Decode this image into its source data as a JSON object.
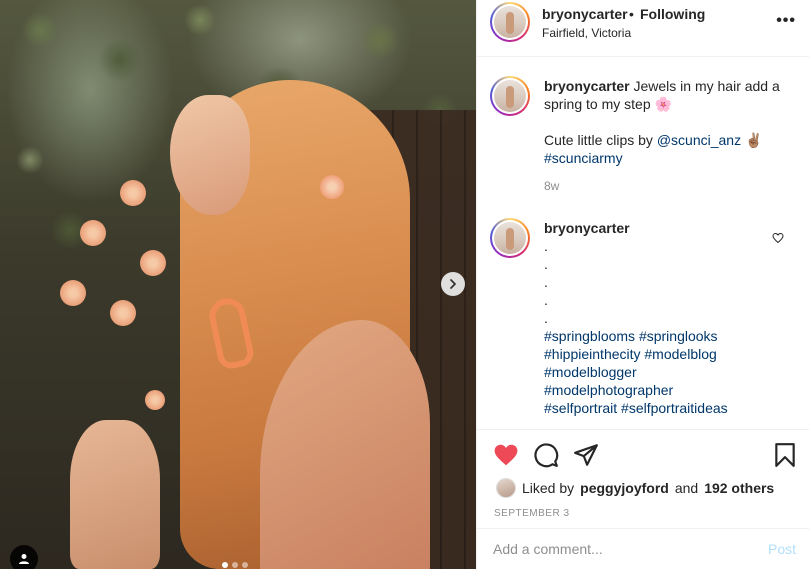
{
  "header": {
    "username": "bryonycarter",
    "separator": "•",
    "follow_status": "Following",
    "location": "Fairfield, Victoria",
    "more_label": "•••"
  },
  "caption": {
    "username": "bryonycarter",
    "text_line1": "Jewels in my hair add a spring to my step",
    "emoji1": "🌸",
    "credit_prefix": "Cute little clips by",
    "credit_mention": "@scunci_anz",
    "emoji2": "✌🏽",
    "hashtag": "#scunciarmy",
    "age": "8w"
  },
  "comment": {
    "username": "bryonycarter",
    "dots": [
      ".",
      ".",
      ".",
      ".",
      "."
    ],
    "hashtags_line1": "#springblooms #springlooks",
    "hashtags_line2": "#hippieinthecity #modelblog",
    "hashtags_line3": "#modelblogger",
    "hashtags_line4": "#modelphotographer",
    "hashtags_line5": "#selfportrait #selfportraitideas"
  },
  "actions": {
    "liked_by_prefix": "Liked by",
    "liked_by_user": "peggyjoyford",
    "liked_by_and": "and",
    "liked_by_others": "192 others",
    "date": "SEPTEMBER 3",
    "comment_placeholder": "Add a comment...",
    "post_label": "Post"
  },
  "colors": {
    "like_red": "#ed4956",
    "link_blue": "#00376b",
    "post_disabled": "#b2dffc"
  },
  "carousel": {
    "slide_count": 3,
    "active_slide": 1
  }
}
